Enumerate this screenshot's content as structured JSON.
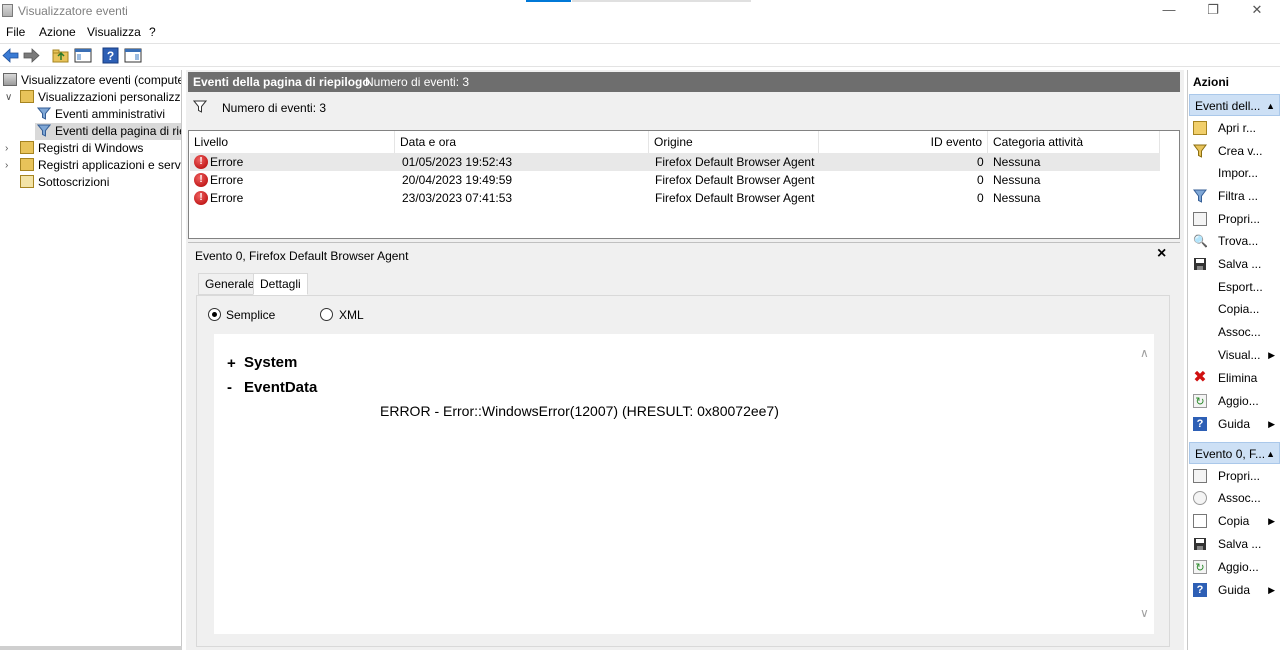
{
  "window": {
    "title": "Visualizzatore eventi"
  },
  "menu": [
    "File",
    "Azione",
    "Visualizza",
    "?"
  ],
  "tree": {
    "root": "Visualizzatore eventi (computer",
    "custom_views": "Visualizzazioni personalizzate",
    "admin_events": "Eventi amministrativi",
    "summary_page_events": "Eventi della pagina di riep",
    "windows_logs": "Registri di Windows",
    "app_service_logs": "Registri applicazioni e servizi",
    "subscriptions": "Sottoscrizioni"
  },
  "summary": {
    "header_title": "Eventi della pagina di riepilogo",
    "header_count": "Numero di eventi: 3",
    "filter_count": "Numero di eventi: 3"
  },
  "grid": {
    "columns": [
      "Livello",
      "Data e ora",
      "Origine",
      "ID evento",
      "Categoria attività"
    ],
    "rows": [
      {
        "level": "Errore",
        "datetime": "01/05/2023 19:52:43",
        "source": "Firefox Default Browser Agent",
        "event_id": "0",
        "category": "Nessuna"
      },
      {
        "level": "Errore",
        "datetime": "20/04/2023 19:49:59",
        "source": "Firefox Default Browser Agent",
        "event_id": "0",
        "category": "Nessuna"
      },
      {
        "level": "Errore",
        "datetime": "23/03/2023 07:41:53",
        "source": "Firefox Default Browser Agent",
        "event_id": "0",
        "category": "Nessuna"
      }
    ]
  },
  "detail": {
    "title": "Evento 0, Firefox Default Browser Agent",
    "close_glyph": "×",
    "tabs": [
      "Generale",
      "Dettagli"
    ],
    "radio_simple": "Semplice",
    "radio_xml": "XML",
    "system_toggle": "+",
    "system_label": "System",
    "eventdata_toggle": "-",
    "eventdata_label": "EventData",
    "eventdata_value": "ERROR - Error::WindowsError(12007) (HRESULT: 0x80072ee7)"
  },
  "actions": {
    "header": "Azioni",
    "section1": "Eventi dell...",
    "items1": [
      "Apri r...",
      "Crea v...",
      "Impor...",
      "Filtra ...",
      "Propri...",
      "Trova...",
      "Salva ...",
      "Esport...",
      "Copia...",
      "Assoc...",
      "Visual...",
      "Elimina",
      "Aggio...",
      "Guida"
    ],
    "section2": "Evento 0, F...",
    "items2": [
      "Propri...",
      "Assoc...",
      "Copia",
      "Salva ...",
      "Aggio...",
      "Guida"
    ]
  },
  "colors": {
    "accent": "#0078d7",
    "section_bg": "#cde0f5",
    "header_bg": "#6e6e6e",
    "error": "#c00000"
  }
}
